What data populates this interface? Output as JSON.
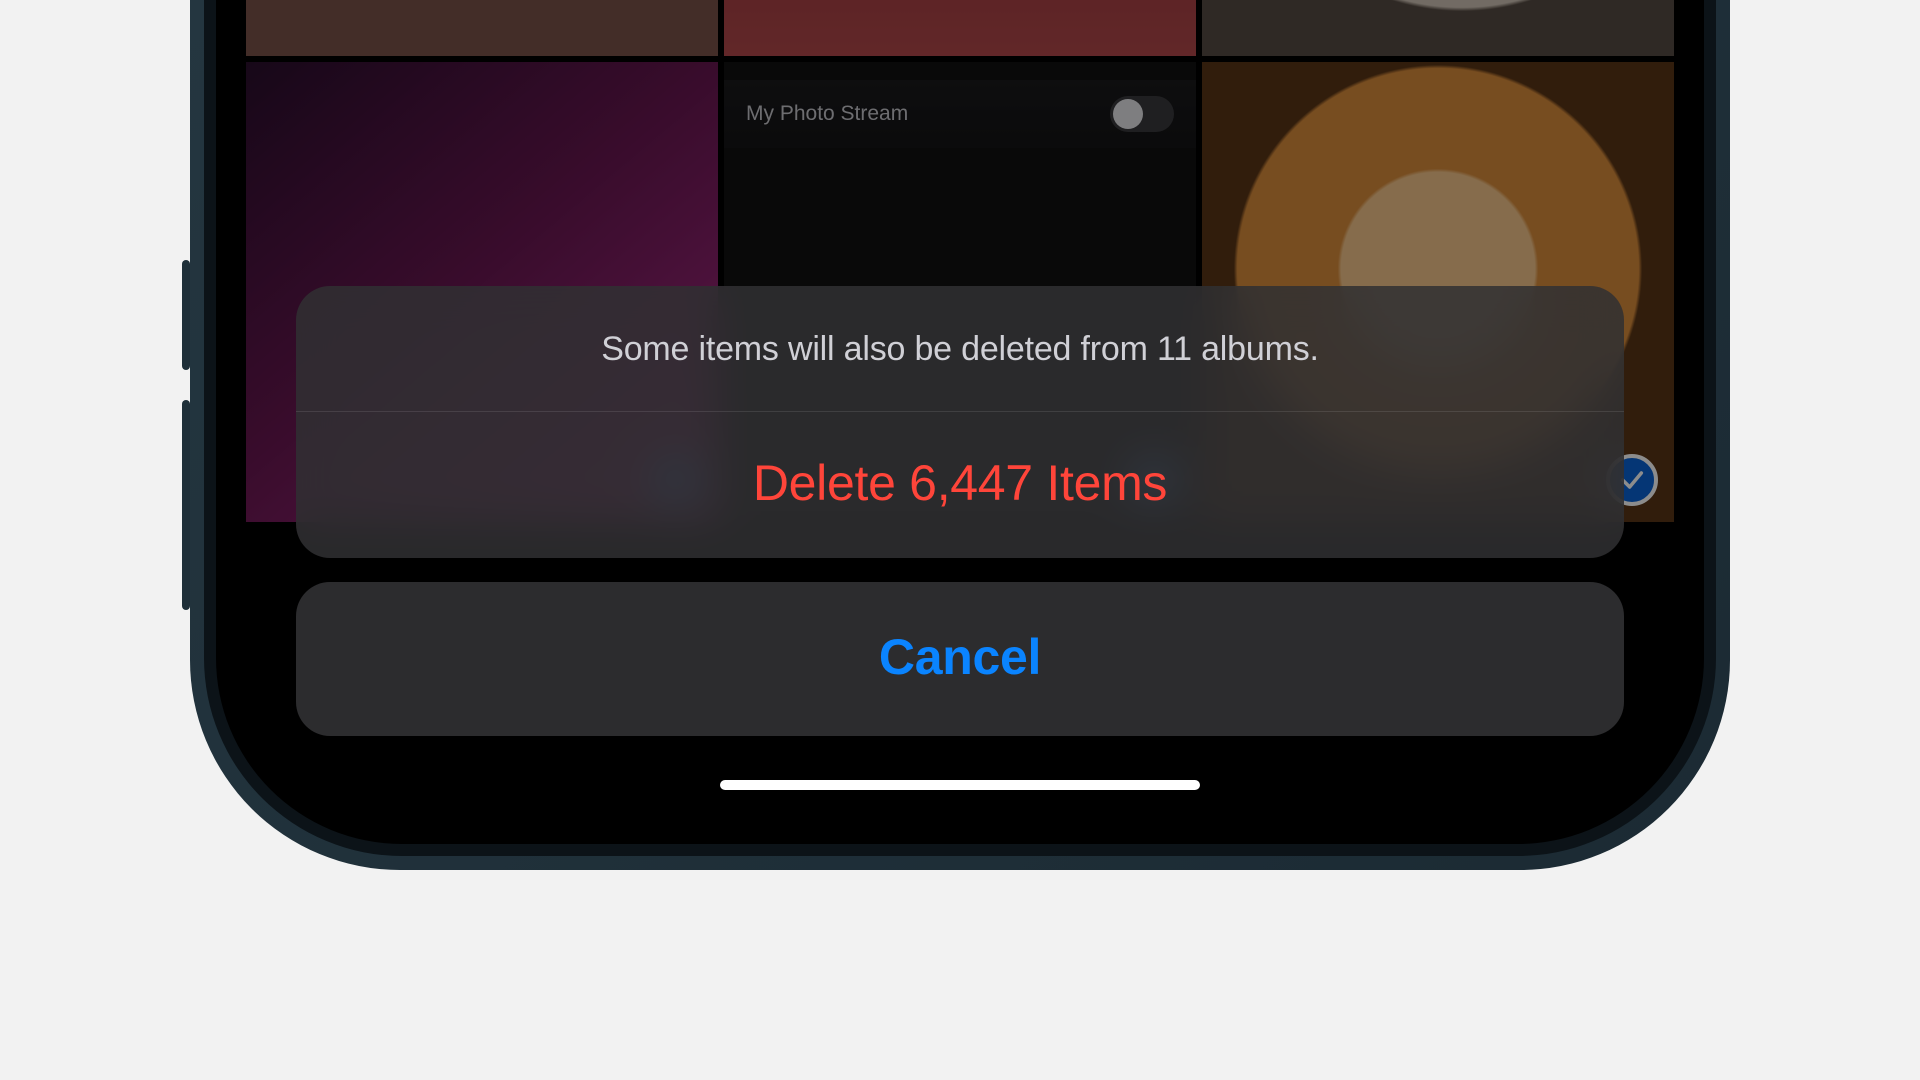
{
  "colors": {
    "accent_blue": "#0a84ff",
    "destructive_red": "#ff453a",
    "check_blue": "#0a63d6",
    "sheet_bg": "rgba(48,48,50,0.85)"
  },
  "background_setting": {
    "label": "My Photo Stream",
    "enabled": false
  },
  "action_sheet": {
    "message": "Some items will also be deleted from 11 albums.",
    "destructive_label": "Delete 6,447 Items",
    "cancel_label": "Cancel"
  },
  "selection": {
    "all_selected": true
  }
}
